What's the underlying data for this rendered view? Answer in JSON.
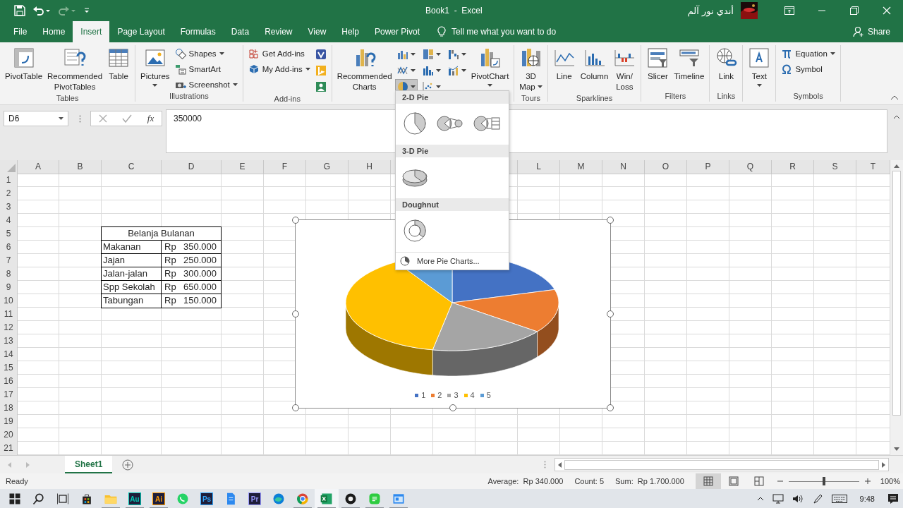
{
  "title_bar": {
    "title": "Book1  -  Excel",
    "user": "أندي نور آلم"
  },
  "tabs": [
    {
      "label": "File",
      "selected": false
    },
    {
      "label": "Home",
      "selected": false
    },
    {
      "label": "Insert",
      "selected": true
    },
    {
      "label": "Page Layout",
      "selected": false
    },
    {
      "label": "Formulas",
      "selected": false
    },
    {
      "label": "Data",
      "selected": false
    },
    {
      "label": "Review",
      "selected": false
    },
    {
      "label": "View",
      "selected": false
    },
    {
      "label": "Help",
      "selected": false
    },
    {
      "label": "Power Pivot",
      "selected": false
    }
  ],
  "tell_me": "Tell me what you want to do",
  "share": "Share",
  "ribbon": [
    {
      "label": "Tables",
      "items": [
        {
          "kind": "large",
          "label": "PivotTable",
          "dropdown": false
        },
        {
          "kind": "large",
          "label": "Recommended\nPivotTables",
          "dropdown": false
        },
        {
          "kind": "large",
          "label": "Table",
          "dropdown": false
        }
      ]
    },
    {
      "label": "Illustrations",
      "items": [
        {
          "kind": "large",
          "label": "Pictures",
          "dropdown": true
        },
        {
          "kind": "stack",
          "items": [
            {
              "label": "Shapes",
              "dropdown": true
            },
            {
              "label": "SmartArt",
              "dropdown": false
            },
            {
              "label": "Screenshot",
              "dropdown": true
            }
          ]
        }
      ]
    },
    {
      "label": "Add-ins",
      "items": [
        {
          "kind": "stack",
          "items": [
            {
              "label": "Get Add-ins",
              "dropdown": false
            },
            {
              "label": "My Add-ins",
              "dropdown": true
            }
          ]
        },
        {
          "kind": "icons",
          "items": [
            {
              "dropdown": false,
              "selected": false
            },
            {
              "dropdown": false,
              "selected": false
            },
            {
              "dropdown": false,
              "selected": false
            }
          ]
        }
      ]
    },
    {
      "items": [
        {
          "kind": "large",
          "label": "Recommended\nCharts",
          "dropdown": false
        },
        {
          "kind": "icons",
          "items": [
            {
              "dropdown": true,
              "selected": false
            },
            {
              "dropdown": true,
              "selected": false
            },
            {
              "dropdown": true,
              "selected": true
            },
            {
              "dropdown": true,
              "selected": false
            },
            {
              "dropdown": true,
              "selected": false
            },
            {
              "dropdown": true,
              "selected": false
            },
            {
              "dropdown": true,
              "selected": false
            },
            {
              "dropdown": true,
              "selected": false
            }
          ]
        },
        {
          "kind": "large",
          "label": "PivotChart",
          "dropdown": true
        }
      ]
    },
    {
      "label": "Tours",
      "items": [
        {
          "kind": "large",
          "label": "3D\nMap",
          "dropdown": true
        }
      ]
    },
    {
      "label": "Sparklines",
      "items": [
        {
          "kind": "large",
          "label": "Line",
          "dropdown": false
        },
        {
          "kind": "large",
          "label": "Column",
          "dropdown": false
        },
        {
          "kind": "large",
          "label": "Win/\nLoss",
          "dropdown": false
        }
      ]
    },
    {
      "label": "Filters",
      "items": [
        {
          "kind": "large",
          "label": "Slicer",
          "dropdown": false
        },
        {
          "kind": "large",
          "label": "Timeline",
          "dropdown": false
        }
      ]
    },
    {
      "label": "Links",
      "items": [
        {
          "kind": "large",
          "label": "Link",
          "dropdown": false
        }
      ]
    },
    {
      "items": [
        {
          "kind": "large",
          "label": "Text",
          "dropdown": true
        }
      ]
    },
    {
      "label": "Symbols",
      "items": [
        {
          "kind": "stack",
          "items": [
            {
              "label": "Equation",
              "dropdown": true
            },
            {
              "label": "Symbol",
              "dropdown": false
            }
          ]
        }
      ]
    }
  ],
  "pie_menu": {
    "sections": [
      {
        "heading": "2-D Pie",
        "options": [
          {
            "kind": "pie"
          },
          {
            "kind": "pie-of-pie"
          },
          {
            "kind": "bar-of-pie"
          }
        ]
      },
      {
        "heading": "3-D Pie",
        "options": [
          {
            "kind": "pie-3d"
          }
        ]
      },
      {
        "heading": "Doughnut",
        "options": [
          {
            "kind": "doughnut"
          }
        ]
      }
    ],
    "more": "More Pie Charts..."
  },
  "formula_bar": {
    "name_box": "D6",
    "function_label": "fx",
    "formula": "350000"
  },
  "sheet": {
    "columns": [
      "A",
      "B",
      "C",
      "D",
      "E",
      "F",
      "G",
      "H"
    ],
    "columns_right": [
      "L",
      "M",
      "N",
      "O",
      "P",
      "Q",
      "R",
      "S",
      "T"
    ],
    "rows": [
      "1",
      "2",
      "3",
      "4",
      "5",
      "6",
      "7",
      "8",
      "9",
      "10",
      "11",
      "12",
      "13",
      "14",
      "15",
      "16",
      "17",
      "18",
      "19",
      "20",
      "21"
    ],
    "table": {
      "title": "Belanja Bulanan",
      "rows": [
        {
          "item": "Makanan",
          "currency": "Rp",
          "amount": "350.000"
        },
        {
          "item": "Jajan",
          "currency": "Rp",
          "amount": "250.000"
        },
        {
          "item": "Jalan-jalan",
          "currency": "Rp",
          "amount": "300.000"
        },
        {
          "item": "Spp Sekolah",
          "currency": "Rp",
          "amount": "650.000"
        },
        {
          "item": "Tabungan",
          "currency": "Rp",
          "amount": "150.000"
        }
      ]
    }
  },
  "chart": {
    "legend": [
      {
        "label": "1",
        "color": "#4472c4"
      },
      {
        "label": "2",
        "color": "#ed7d31"
      },
      {
        "label": "3",
        "color": "#a5a5a5"
      },
      {
        "label": "4",
        "color": "#ffc000"
      },
      {
        "label": "5",
        "color": "#5b9bd5"
      }
    ]
  },
  "sheet_tabs": [
    {
      "label": "Sheet1",
      "selected": true
    }
  ],
  "status_bar": {
    "mode": "Ready",
    "average": "Average:  Rp 340.000",
    "count": "Count: 5",
    "sum": "Sum:  Rp 1.700.000",
    "views": [
      {
        "kind": "normal",
        "selected": true
      },
      {
        "kind": "page-layout",
        "selected": false
      },
      {
        "kind": "page-break",
        "selected": false
      }
    ],
    "zoom": {
      "level": 0.5
    },
    "zoom_label": "100%"
  },
  "taskbar": {
    "apps": [
      {
        "kind": "start",
        "running": false
      },
      {
        "kind": "search",
        "running": false
      },
      {
        "kind": "task-view",
        "running": false
      },
      {
        "kind": "store",
        "running": false
      },
      {
        "kind": "folder",
        "running": true
      },
      {
        "kind": "letter",
        "label": "Au",
        "color": "#00c8b4",
        "running": true
      },
      {
        "kind": "letter",
        "label": "Ai",
        "color": "#ff9a00",
        "running": true
      },
      {
        "kind": "chat",
        "running": false
      },
      {
        "kind": "letter",
        "label": "Ps",
        "color": "#31a8ff",
        "running": false
      },
      {
        "kind": "file",
        "running": false
      },
      {
        "kind": "letter",
        "label": "Pr",
        "color": "#9999ff",
        "running": false
      },
      {
        "kind": "browser",
        "running": false
      },
      {
        "kind": "chrome",
        "running": true
      },
      {
        "kind": "excel",
        "running": true
      },
      {
        "kind": "record",
        "running": true
      },
      {
        "kind": "green-app",
        "running": true
      },
      {
        "kind": "window-app",
        "running": true
      }
    ],
    "time": "9:48"
  }
}
